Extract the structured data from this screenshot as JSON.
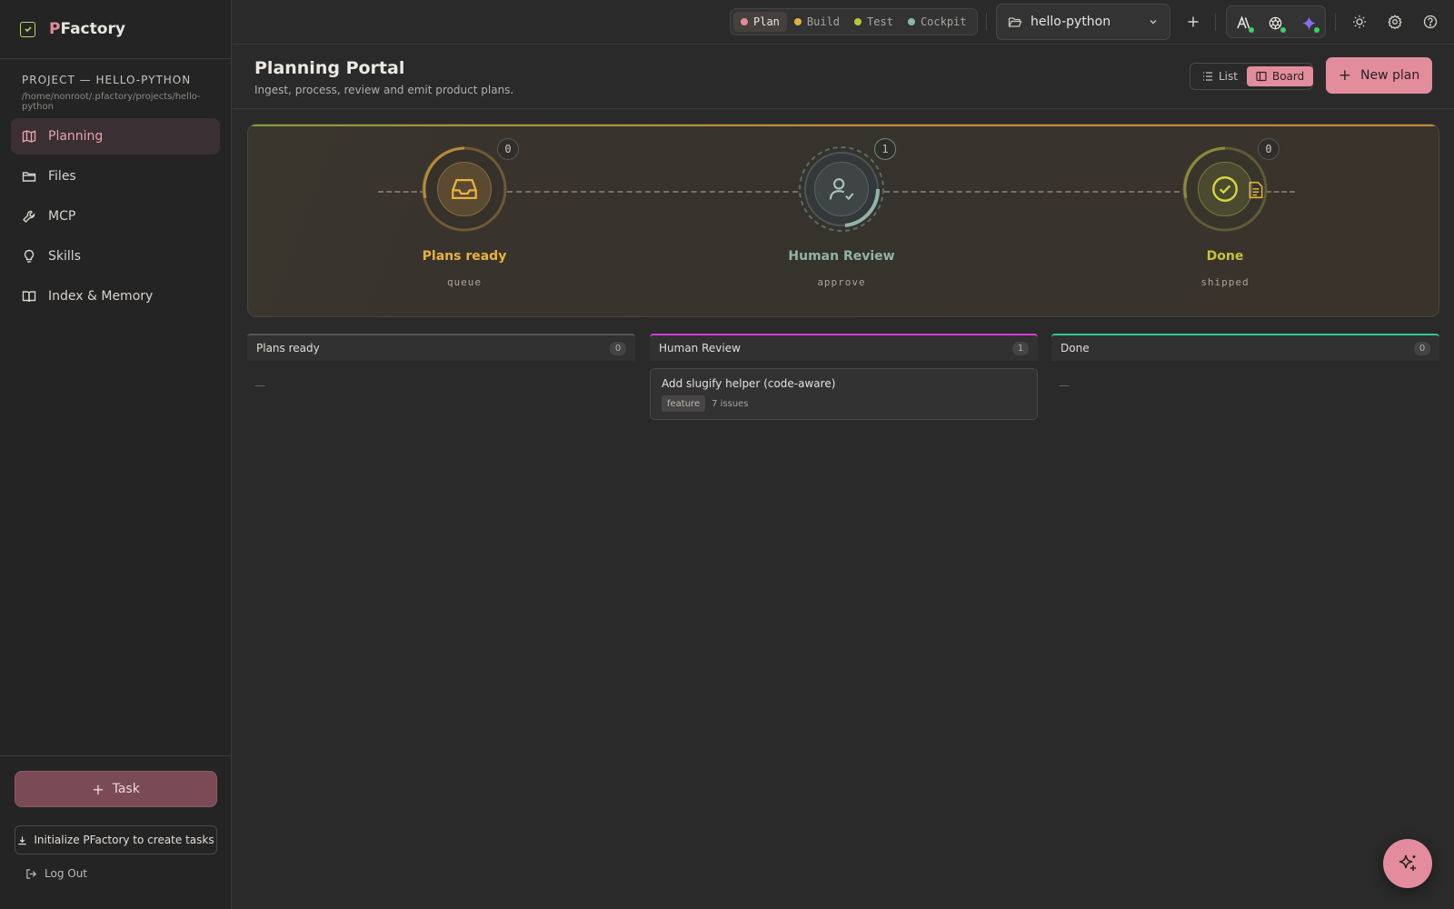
{
  "app": {
    "brand_first": "P",
    "brand_rest": "Factory"
  },
  "project": {
    "label": "PROJECT — HELLO-PYTHON",
    "path": "/home/nonroot/.pfactory/projects/hello-python"
  },
  "sidebar": {
    "items": [
      {
        "label": "Planning",
        "icon": "map-icon",
        "active": true
      },
      {
        "label": "Files",
        "icon": "folder-icon"
      },
      {
        "label": "MCP",
        "icon": "wrench-icon"
      },
      {
        "label": "Skills",
        "icon": "lightbulb-icon"
      },
      {
        "label": "Index & Memory",
        "icon": "book-icon"
      }
    ],
    "task_label": "Task",
    "init_label": "Initialize PFactory to create tasks",
    "logout_label": "Log Out"
  },
  "topbar": {
    "modes": [
      {
        "label": "Plan",
        "color": "#e58a9a",
        "active": true
      },
      {
        "label": "Build",
        "color": "#e0b33a"
      },
      {
        "label": "Test",
        "color": "#b9c43a"
      },
      {
        "label": "Cockpit",
        "color": "#8fb5a8"
      }
    ],
    "project_name": "hello-python"
  },
  "header": {
    "title": "Planning Portal",
    "subtitle": "Ingest, process, review and emit product plans.",
    "view_list": "List",
    "view_board": "Board",
    "new_plan": "New plan"
  },
  "pipeline": {
    "stages": [
      {
        "name": "Plans ready",
        "sub": "queue",
        "count": "0",
        "color": "#e9b23f"
      },
      {
        "name": "Human Review",
        "sub": "approve",
        "count": "1",
        "color": "#8fb5a8"
      },
      {
        "name": "Done",
        "sub": "shipped",
        "count": "0",
        "color": "#c6c43a"
      }
    ]
  },
  "board": {
    "columns": [
      {
        "title": "Plans ready",
        "count": "0",
        "empty": "—",
        "accent": "#5a5a5a"
      },
      {
        "title": "Human Review",
        "count": "1",
        "accent": "#d63bd6",
        "cards": [
          {
            "title": "Add slugify helper (code-aware)",
            "tag": "feature",
            "issues": "7 issues"
          }
        ]
      },
      {
        "title": "Done",
        "count": "0",
        "empty": "—",
        "accent": "#2fc79a"
      }
    ]
  }
}
